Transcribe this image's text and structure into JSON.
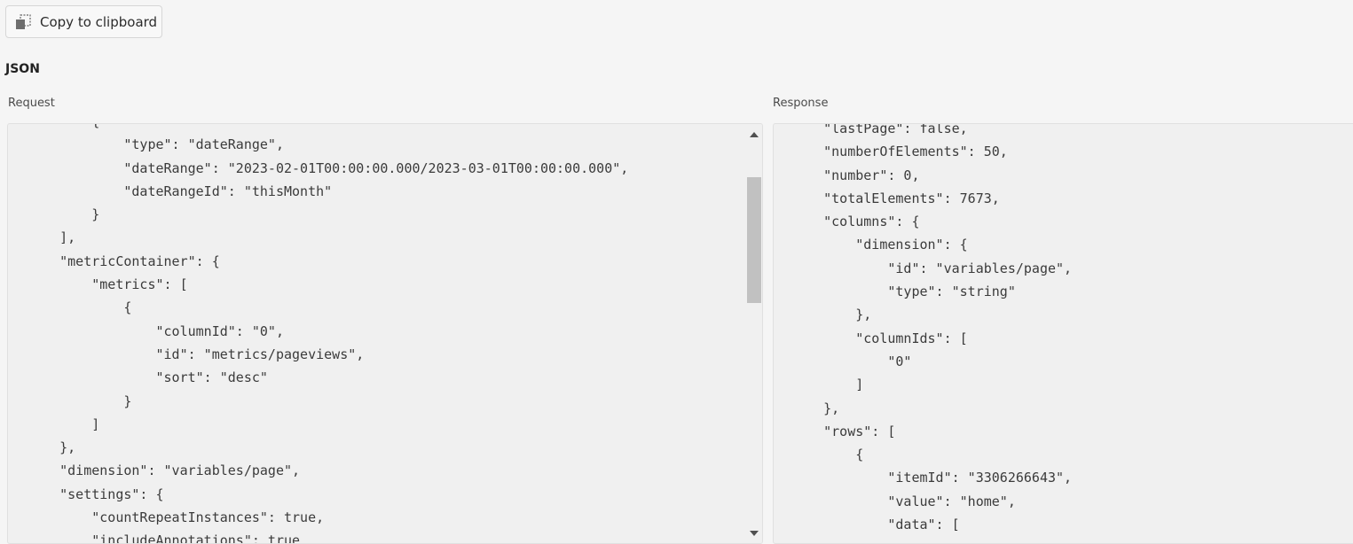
{
  "toolbar": {
    "copy_label": "Copy to clipboard",
    "copy_icon": "copy-icon"
  },
  "section": {
    "title": "JSON"
  },
  "panes": {
    "request_label": "Request",
    "response_label": "Response"
  },
  "request_lines": [
    "        {",
    "            \"type\": \"dateRange\",",
    "            \"dateRange\": \"2023-02-01T00:00:00.000/2023-03-01T00:00:00.000\",",
    "            \"dateRangeId\": \"thisMonth\"",
    "        }",
    "    ],",
    "    \"metricContainer\": {",
    "        \"metrics\": [",
    "            {",
    "                \"columnId\": \"0\",",
    "                \"id\": \"metrics/pageviews\",",
    "                \"sort\": \"desc\"",
    "            }",
    "        ]",
    "    },",
    "    \"dimension\": \"variables/page\",",
    "    \"settings\": {",
    "        \"countRepeatInstances\": true,",
    "        \"includeAnnotations\": true"
  ],
  "response_lines": [
    "    \"lastPage\": false,",
    "    \"numberOfElements\": 50,",
    "    \"number\": 0,",
    "    \"totalElements\": 7673,",
    "    \"columns\": {",
    "        \"dimension\": {",
    "            \"id\": \"variables/page\",",
    "            \"type\": \"string\"",
    "        },",
    "        \"columnIds\": [",
    "            \"0\"",
    "        ]",
    "    },",
    "    \"rows\": [",
    "        {",
    "            \"itemId\": \"3306266643\",",
    "            \"value\": \"home\",",
    "            \"data\": ["
  ]
}
